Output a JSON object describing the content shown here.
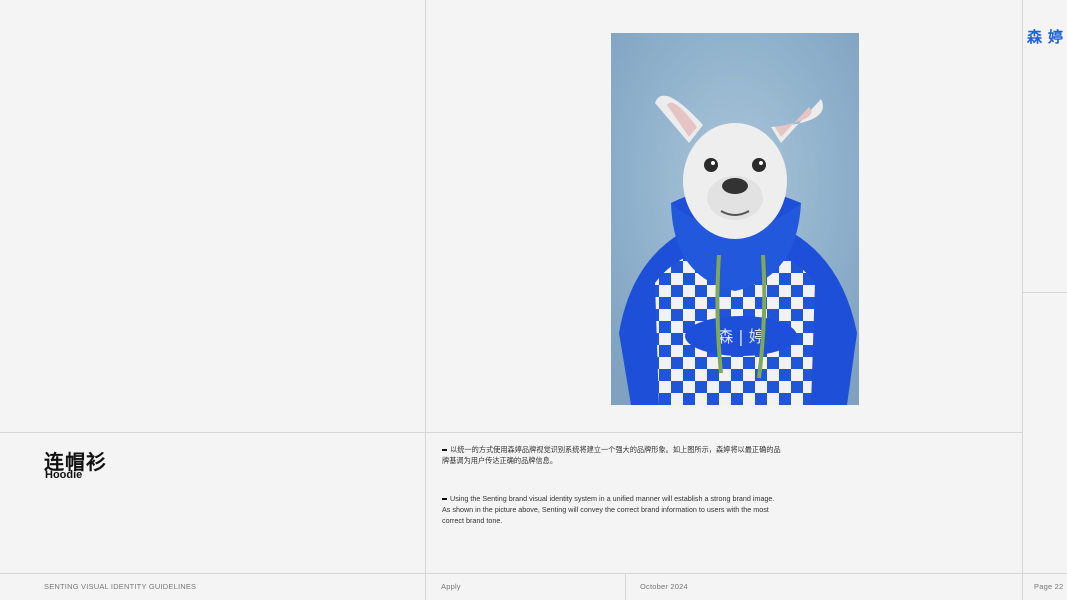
{
  "logo": {
    "char1": "森",
    "char2": "婷"
  },
  "product": {
    "title_cn": "连帽衫",
    "title_en": "Hoodie"
  },
  "description": {
    "cn": "以统一的方式使用森婷品牌视觉识别系统将建立一个强大的品牌形象。如上图所示，森婷将以最正确的品牌基调为用户传达正确的品牌信息。",
    "en": "Using the Senting brand visual identity system in a unified manner will establish a strong brand image. As shown in the picture above, Senting will convey the correct brand information to users with the most correct brand tone."
  },
  "footer": {
    "brand": "SENTING  VISUAL IDENTITY GUIDELINES",
    "section": "Apply",
    "date": "October 2024",
    "page": "Page 22"
  },
  "colors": {
    "brand_blue": "#1f62d8",
    "background": "#f4f4f4",
    "photo_bg": "#8fb3cf"
  },
  "image": {
    "subject": "french-bulldog-wearing-blue-checkered-hoodie"
  }
}
